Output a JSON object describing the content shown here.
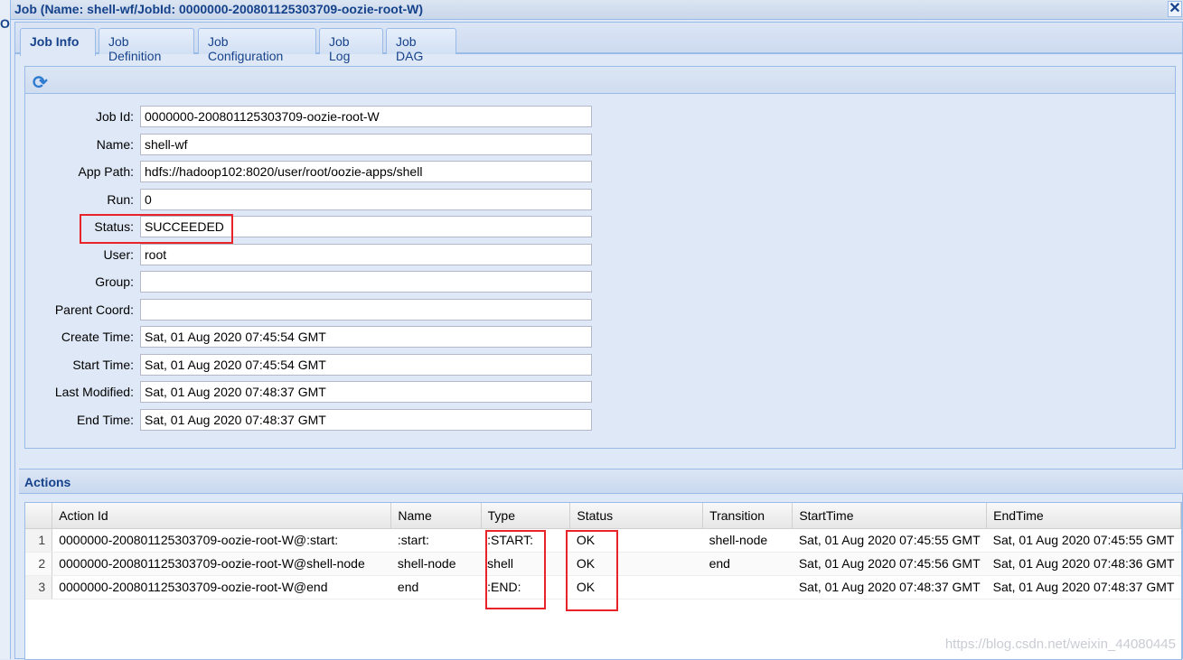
{
  "background": {
    "console_initial": "O"
  },
  "window": {
    "title": "Job (Name: shell-wf/JobId: 0000000-200801125303709-oozie-root-W)",
    "close": "✕"
  },
  "tabs": [
    {
      "label": "Job Info",
      "active": true
    },
    {
      "label": "Job Definition"
    },
    {
      "label": "Job Configuration"
    },
    {
      "label": "Job Log"
    },
    {
      "label": "Job DAG"
    }
  ],
  "toolbar": {
    "refresh_icon": "refresh-icon",
    "refresh_glyph": "⟳"
  },
  "fields": [
    {
      "label": "Job Id:",
      "value": "0000000-200801125303709-oozie-root-W"
    },
    {
      "label": "Name:",
      "value": "shell-wf"
    },
    {
      "label": "App Path:",
      "value": "hdfs://hadoop102:8020/user/root/oozie-apps/shell"
    },
    {
      "label": "Run:",
      "value": "0"
    },
    {
      "label": "Status:",
      "value": "SUCCEEDED"
    },
    {
      "label": "User:",
      "value": "root"
    },
    {
      "label": "Group:",
      "value": ""
    },
    {
      "label": "Parent Coord:",
      "value": ""
    },
    {
      "label": "Create Time:",
      "value": "Sat, 01 Aug 2020 07:45:54 GMT"
    },
    {
      "label": "Start Time:",
      "value": "Sat, 01 Aug 2020 07:45:54 GMT"
    },
    {
      "label": "Last Modified:",
      "value": "Sat, 01 Aug 2020 07:48:37 GMT"
    },
    {
      "label": "End Time:",
      "value": "Sat, 01 Aug 2020 07:48:37 GMT"
    }
  ],
  "actions": {
    "title": "Actions",
    "columns": [
      "Action Id",
      "Name",
      "Type",
      "Status",
      "Transition",
      "StartTime",
      "EndTime"
    ],
    "rows": [
      [
        "1",
        "0000000-200801125303709-oozie-root-W@:start:",
        ":start:",
        ":START:",
        "OK",
        "shell-node",
        "Sat, 01 Aug 2020 07:45:55 GMT",
        "Sat, 01 Aug 2020 07:45:55 GMT"
      ],
      [
        "2",
        "0000000-200801125303709-oozie-root-W@shell-node",
        "shell-node",
        "shell",
        "OK",
        "end",
        "Sat, 01 Aug 2020 07:45:56 GMT",
        "Sat, 01 Aug 2020 07:48:36 GMT"
      ],
      [
        "3",
        "0000000-200801125303709-oozie-root-W@end",
        "end",
        ":END:",
        "OK",
        "",
        "Sat, 01 Aug 2020 07:48:37 GMT",
        "Sat, 01 Aug 2020 07:48:37 GMT"
      ]
    ]
  },
  "highlight_color": "#e8232a",
  "watermark": "https://blog.csdn.net/weixin_44080445"
}
